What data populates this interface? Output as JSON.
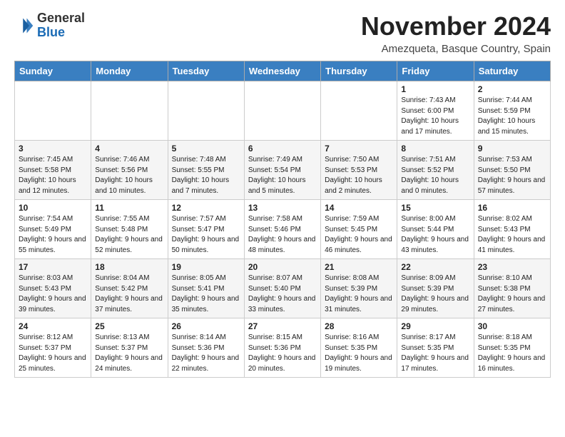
{
  "logo": {
    "general": "General",
    "blue": "Blue"
  },
  "title": "November 2024",
  "location": "Amezqueta, Basque Country, Spain",
  "header": {
    "days": [
      "Sunday",
      "Monday",
      "Tuesday",
      "Wednesday",
      "Thursday",
      "Friday",
      "Saturday"
    ]
  },
  "weeks": [
    {
      "cells": [
        {
          "day": null,
          "info": null
        },
        {
          "day": null,
          "info": null
        },
        {
          "day": null,
          "info": null
        },
        {
          "day": null,
          "info": null
        },
        {
          "day": null,
          "info": null
        },
        {
          "day": "1",
          "info": "Sunrise: 7:43 AM\nSunset: 6:00 PM\nDaylight: 10 hours and 17 minutes."
        },
        {
          "day": "2",
          "info": "Sunrise: 7:44 AM\nSunset: 5:59 PM\nDaylight: 10 hours and 15 minutes."
        }
      ]
    },
    {
      "cells": [
        {
          "day": "3",
          "info": "Sunrise: 7:45 AM\nSunset: 5:58 PM\nDaylight: 10 hours and 12 minutes."
        },
        {
          "day": "4",
          "info": "Sunrise: 7:46 AM\nSunset: 5:56 PM\nDaylight: 10 hours and 10 minutes."
        },
        {
          "day": "5",
          "info": "Sunrise: 7:48 AM\nSunset: 5:55 PM\nDaylight: 10 hours and 7 minutes."
        },
        {
          "day": "6",
          "info": "Sunrise: 7:49 AM\nSunset: 5:54 PM\nDaylight: 10 hours and 5 minutes."
        },
        {
          "day": "7",
          "info": "Sunrise: 7:50 AM\nSunset: 5:53 PM\nDaylight: 10 hours and 2 minutes."
        },
        {
          "day": "8",
          "info": "Sunrise: 7:51 AM\nSunset: 5:52 PM\nDaylight: 10 hours and 0 minutes."
        },
        {
          "day": "9",
          "info": "Sunrise: 7:53 AM\nSunset: 5:50 PM\nDaylight: 9 hours and 57 minutes."
        }
      ]
    },
    {
      "cells": [
        {
          "day": "10",
          "info": "Sunrise: 7:54 AM\nSunset: 5:49 PM\nDaylight: 9 hours and 55 minutes."
        },
        {
          "day": "11",
          "info": "Sunrise: 7:55 AM\nSunset: 5:48 PM\nDaylight: 9 hours and 52 minutes."
        },
        {
          "day": "12",
          "info": "Sunrise: 7:57 AM\nSunset: 5:47 PM\nDaylight: 9 hours and 50 minutes."
        },
        {
          "day": "13",
          "info": "Sunrise: 7:58 AM\nSunset: 5:46 PM\nDaylight: 9 hours and 48 minutes."
        },
        {
          "day": "14",
          "info": "Sunrise: 7:59 AM\nSunset: 5:45 PM\nDaylight: 9 hours and 46 minutes."
        },
        {
          "day": "15",
          "info": "Sunrise: 8:00 AM\nSunset: 5:44 PM\nDaylight: 9 hours and 43 minutes."
        },
        {
          "day": "16",
          "info": "Sunrise: 8:02 AM\nSunset: 5:43 PM\nDaylight: 9 hours and 41 minutes."
        }
      ]
    },
    {
      "cells": [
        {
          "day": "17",
          "info": "Sunrise: 8:03 AM\nSunset: 5:43 PM\nDaylight: 9 hours and 39 minutes."
        },
        {
          "day": "18",
          "info": "Sunrise: 8:04 AM\nSunset: 5:42 PM\nDaylight: 9 hours and 37 minutes."
        },
        {
          "day": "19",
          "info": "Sunrise: 8:05 AM\nSunset: 5:41 PM\nDaylight: 9 hours and 35 minutes."
        },
        {
          "day": "20",
          "info": "Sunrise: 8:07 AM\nSunset: 5:40 PM\nDaylight: 9 hours and 33 minutes."
        },
        {
          "day": "21",
          "info": "Sunrise: 8:08 AM\nSunset: 5:39 PM\nDaylight: 9 hours and 31 minutes."
        },
        {
          "day": "22",
          "info": "Sunrise: 8:09 AM\nSunset: 5:39 PM\nDaylight: 9 hours and 29 minutes."
        },
        {
          "day": "23",
          "info": "Sunrise: 8:10 AM\nSunset: 5:38 PM\nDaylight: 9 hours and 27 minutes."
        }
      ]
    },
    {
      "cells": [
        {
          "day": "24",
          "info": "Sunrise: 8:12 AM\nSunset: 5:37 PM\nDaylight: 9 hours and 25 minutes."
        },
        {
          "day": "25",
          "info": "Sunrise: 8:13 AM\nSunset: 5:37 PM\nDaylight: 9 hours and 24 minutes."
        },
        {
          "day": "26",
          "info": "Sunrise: 8:14 AM\nSunset: 5:36 PM\nDaylight: 9 hours and 22 minutes."
        },
        {
          "day": "27",
          "info": "Sunrise: 8:15 AM\nSunset: 5:36 PM\nDaylight: 9 hours and 20 minutes."
        },
        {
          "day": "28",
          "info": "Sunrise: 8:16 AM\nSunset: 5:35 PM\nDaylight: 9 hours and 19 minutes."
        },
        {
          "day": "29",
          "info": "Sunrise: 8:17 AM\nSunset: 5:35 PM\nDaylight: 9 hours and 17 minutes."
        },
        {
          "day": "30",
          "info": "Sunrise: 8:18 AM\nSunset: 5:35 PM\nDaylight: 9 hours and 16 minutes."
        }
      ]
    }
  ]
}
